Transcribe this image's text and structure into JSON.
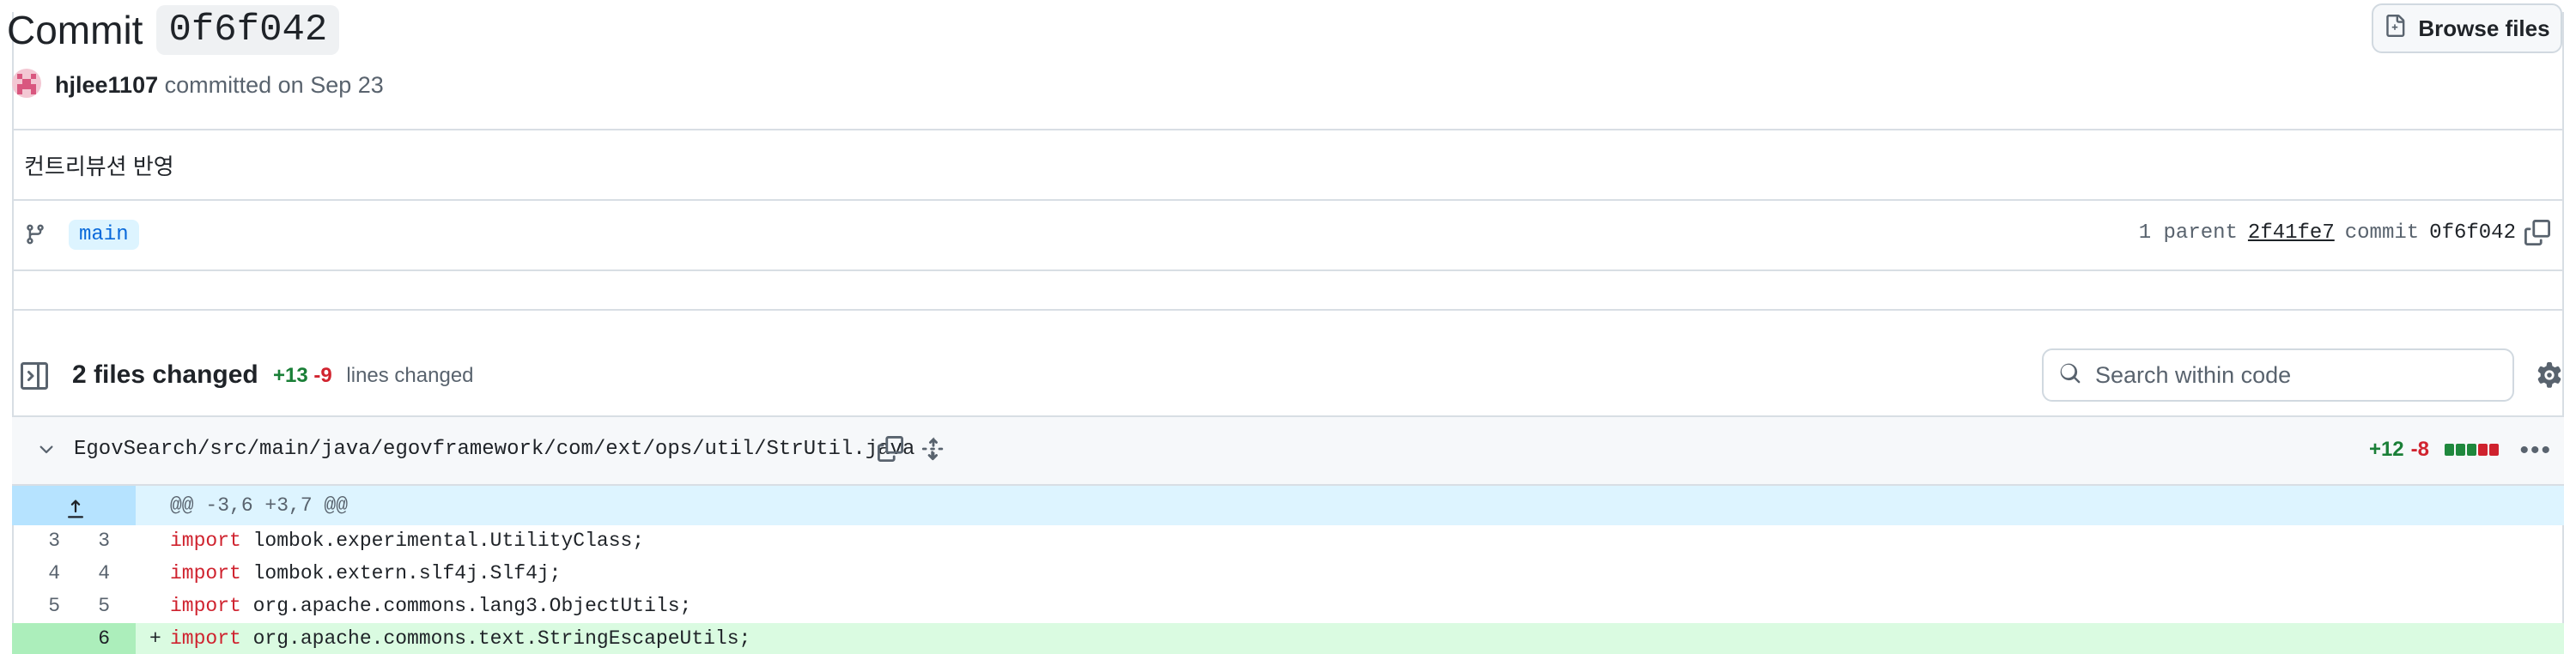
{
  "commit": {
    "title_prefix": "Commit",
    "short_sha": "0f6f042",
    "browse_label": "Browse files",
    "author": "hjlee1107",
    "action_text": "committed on Sep 23",
    "message": "컨트리뷰션 반영",
    "branch": "main",
    "parent_label": "1 parent",
    "parent_sha": "2f41fe7",
    "commit_label": "commit",
    "commit_sha": "0f6f042"
  },
  "summary": {
    "files_changed": "2 files changed",
    "additions": "+13",
    "deletions": "-9",
    "lines_label": "lines changed",
    "search_placeholder": "Search within code"
  },
  "file": {
    "path": "EgovSearch/src/main/java/egovframework/com/ext/ops/util/StrUtil.java",
    "additions": "+12",
    "deletions": "-8",
    "diffstat_blocks": [
      "add",
      "add",
      "add",
      "del",
      "del"
    ],
    "colors": {
      "add": "#1f883d",
      "del": "#cf222e",
      "neutral": "#d1d9e0"
    }
  },
  "diff": {
    "hunk_header": "@@ -3,6 +3,7 @@",
    "lines": [
      {
        "old": "3",
        "new": "3",
        "sign": "",
        "keyword": "import",
        "text": " lombok.experimental.UtilityClass;"
      },
      {
        "old": "4",
        "new": "4",
        "sign": "",
        "keyword": "import",
        "text": " lombok.extern.slf4j.Slf4j;"
      },
      {
        "old": "5",
        "new": "5",
        "sign": "",
        "keyword": "import",
        "text": " org.apache.commons.lang3.ObjectUtils;"
      },
      {
        "old": "",
        "new": "6",
        "sign": "+",
        "keyword": "import",
        "text": " org.apache.commons.text.StringEscapeUtils;"
      }
    ]
  },
  "icons": [
    "file-diff-icon",
    "branch-icon",
    "copy-icon",
    "sidebar-toggle-icon",
    "search-icon",
    "gear-icon",
    "chevron-down-icon",
    "unfold-icon",
    "kebab-icon",
    "expand-up-icon"
  ]
}
